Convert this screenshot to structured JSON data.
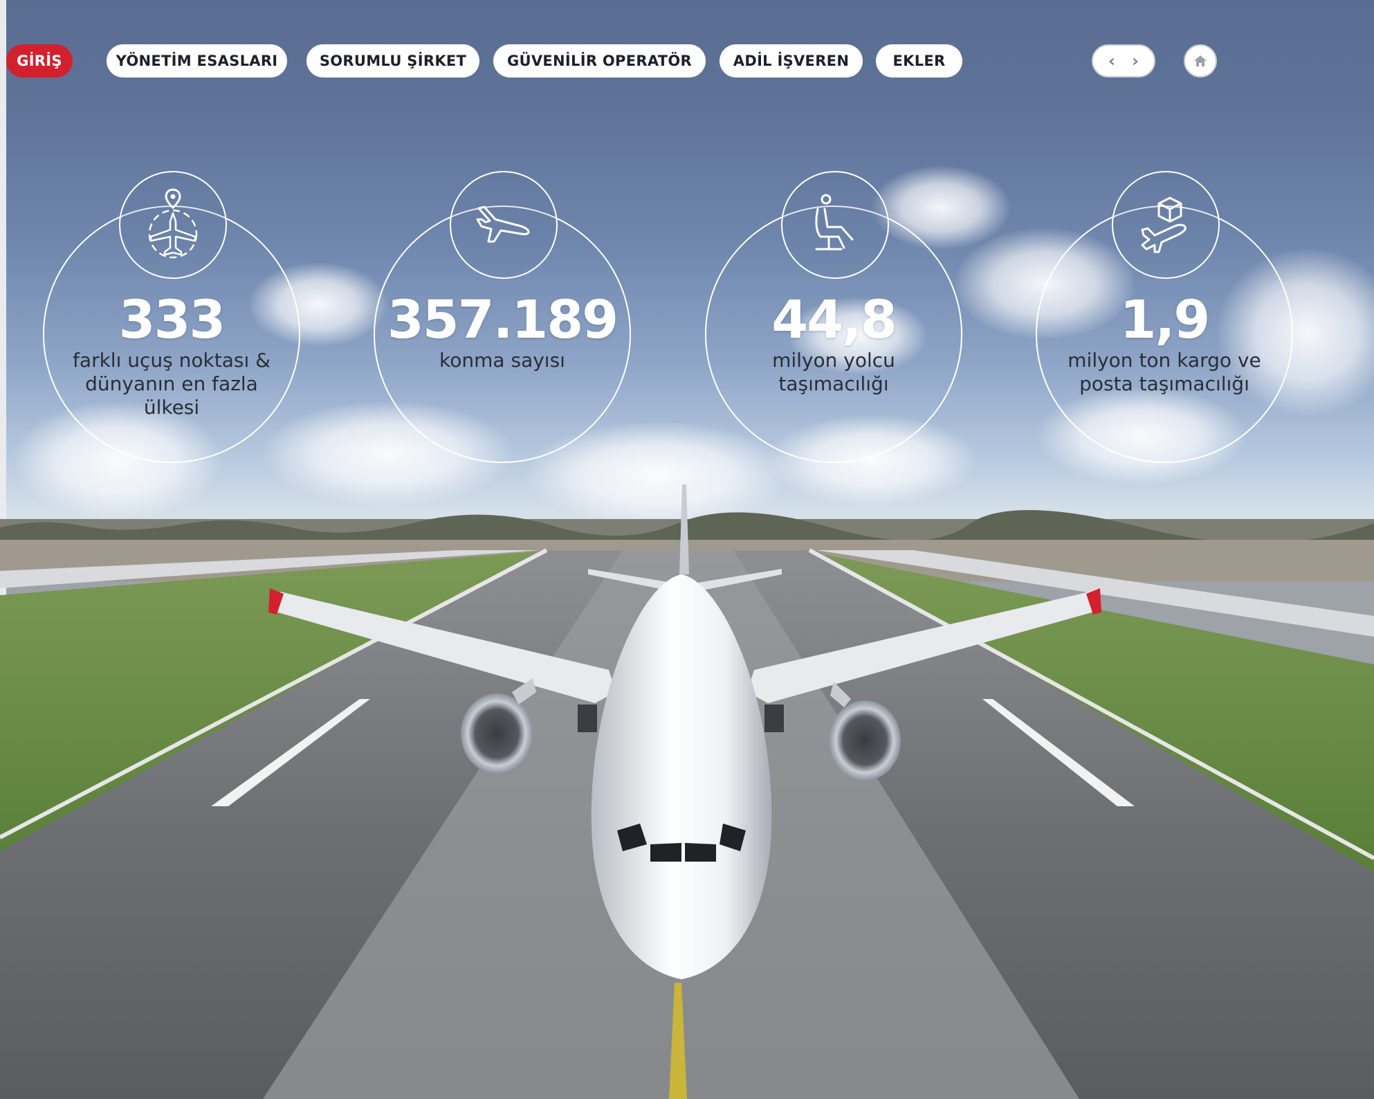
{
  "nav": {
    "items": [
      {
        "label": "GİRİŞ",
        "active": true
      },
      {
        "label": "YÖNETİM ESASLARI",
        "active": false
      },
      {
        "label": "SORUMLU ŞİRKET",
        "active": false
      },
      {
        "label": "GÜVENİLİR OPERATÖR",
        "active": false
      },
      {
        "label": "ADİL İŞVEREN",
        "active": false
      },
      {
        "label": "EKLER",
        "active": false
      }
    ],
    "prev_icon": "chevron-left-icon",
    "next_icon": "chevron-right-icon",
    "home_icon": "home-icon",
    "prev_glyph": "‹",
    "next_glyph": "›"
  },
  "stats": [
    {
      "icon": "plane-globe-pin-icon",
      "value": "333",
      "label": "farklı uçuş noktası &\ndünyanın en fazla\nülkesi"
    },
    {
      "icon": "plane-landing-icon",
      "value": "357.189",
      "label": "konma sayısı"
    },
    {
      "icon": "passenger-seat-icon",
      "value": "44,8",
      "label": "milyon yolcu\ntaşımacılığı"
    },
    {
      "icon": "cargo-plane-icon",
      "value": "1,9",
      "label": "milyon ton kargo ve\nposta taşımacılığı"
    }
  ],
  "colors": {
    "accent": "#d3202f",
    "sky_top": "#5a6c91",
    "white": "#ffffff"
  },
  "background": {
    "scene": "airplane-on-runway-photo"
  }
}
